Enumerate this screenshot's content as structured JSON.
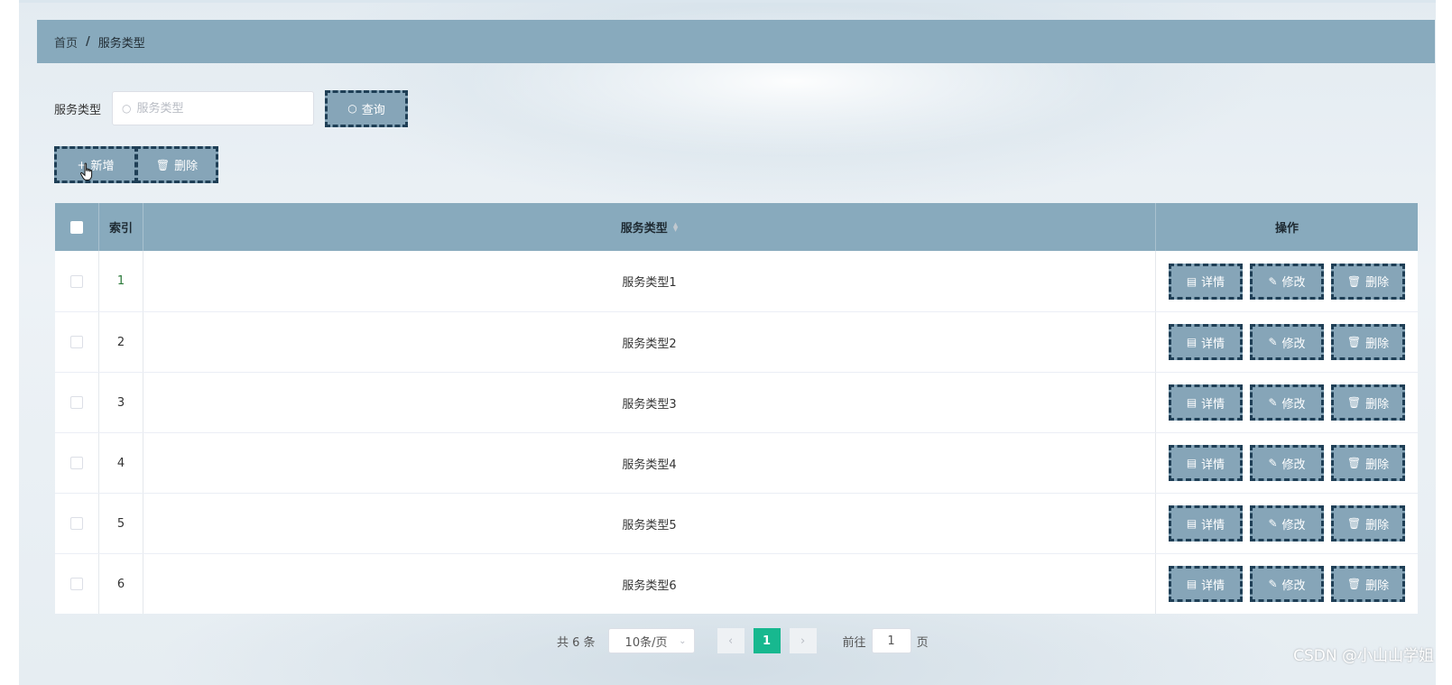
{
  "breadcrumb": {
    "home": "首页",
    "separator": "/",
    "current": "服务类型"
  },
  "search": {
    "label": "服务类型",
    "placeholder": "服务类型",
    "value": "",
    "button_label": "查询",
    "button_icon": "search-icon"
  },
  "actions": {
    "add_label": "新增",
    "add_icon": "plus-icon",
    "delete_label": "删除",
    "delete_icon": "trash-icon"
  },
  "table": {
    "headers": {
      "index": "索引",
      "type": "服务类型",
      "ops": "操作"
    },
    "rows": [
      {
        "index": "1",
        "type": "服务类型1"
      },
      {
        "index": "2",
        "type": "服务类型2"
      },
      {
        "index": "3",
        "type": "服务类型3"
      },
      {
        "index": "4",
        "type": "服务类型4"
      },
      {
        "index": "5",
        "type": "服务类型5"
      },
      {
        "index": "6",
        "type": "服务类型6"
      }
    ],
    "row_actions": {
      "detail": "详情",
      "edit": "修改",
      "delete": "删除"
    }
  },
  "pagination": {
    "total": "共 6 条",
    "page_size": "10条/页",
    "current_page": "1",
    "goto_prefix": "前往",
    "goto_value": "1",
    "goto_suffix": "页"
  },
  "watermark": "CSDN @小山山学姐",
  "colors": {
    "header_bg": "#88aabd",
    "button_bg": "#86a5b8",
    "button_border": "#1f3f56",
    "active_page": "#17b88f"
  }
}
